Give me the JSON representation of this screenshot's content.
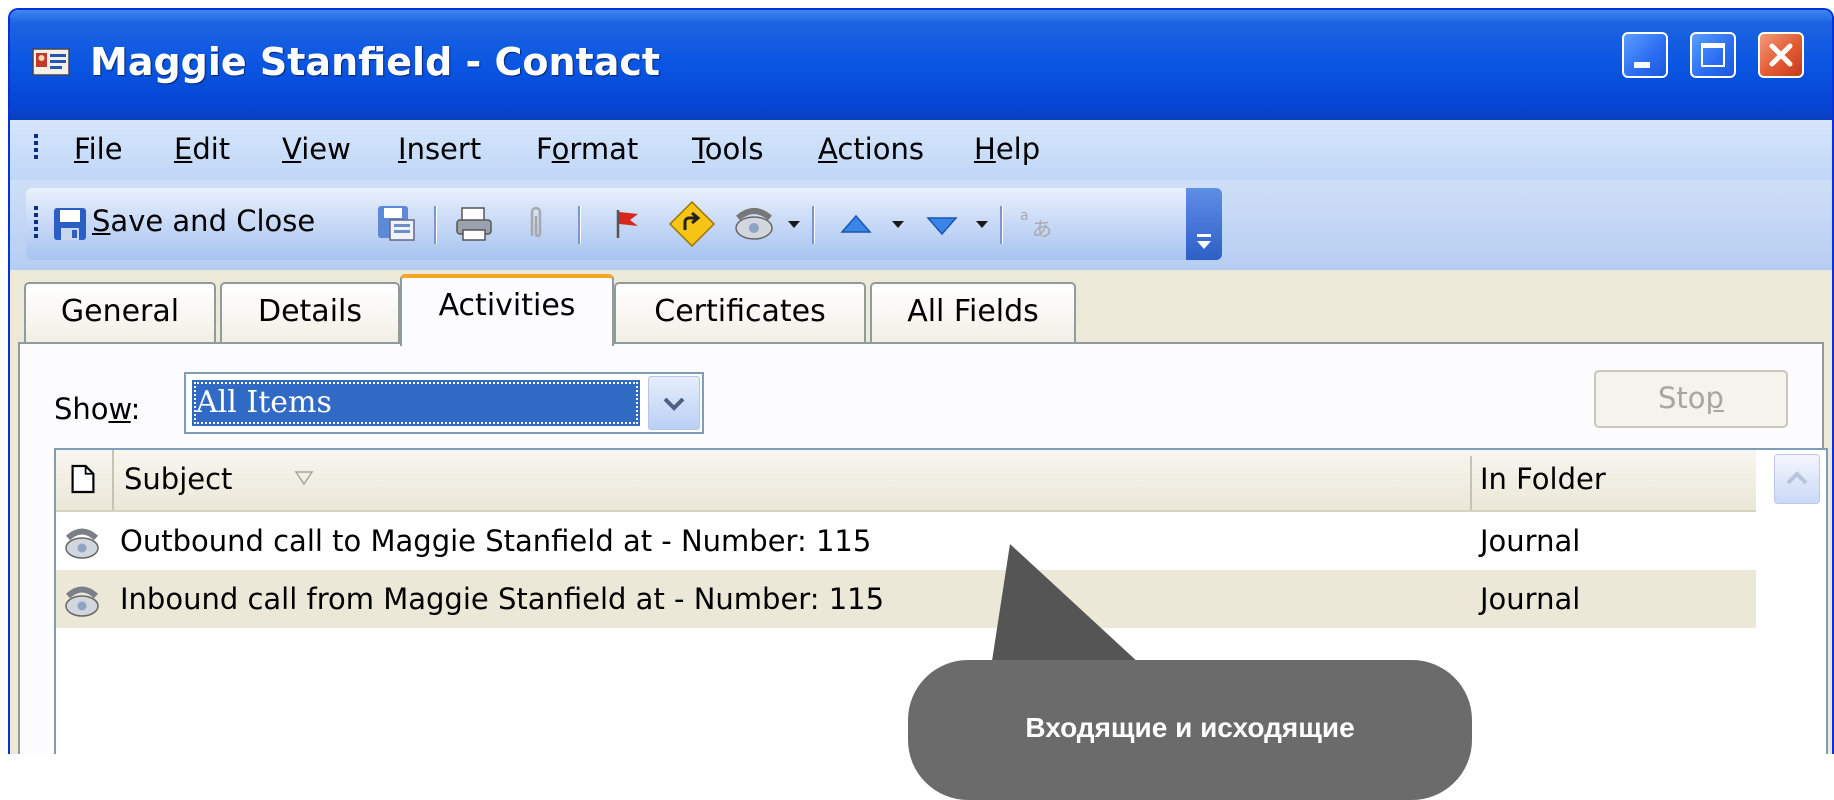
{
  "window": {
    "title": "Maggie Stanfield - Contact",
    "title_icon": "contact-card-icon",
    "controls": [
      "minimize-icon",
      "maximize-icon",
      "close-icon"
    ]
  },
  "menu": {
    "items": [
      {
        "label": "File",
        "accel": "F"
      },
      {
        "label": "Edit",
        "accel": "E"
      },
      {
        "label": "View",
        "accel": "V"
      },
      {
        "label": "Insert",
        "accel": "I"
      },
      {
        "label": "Format",
        "accel": "o"
      },
      {
        "label": "Tools",
        "accel": "T"
      },
      {
        "label": "Actions",
        "accel": "A"
      },
      {
        "label": "Help",
        "accel": "H"
      }
    ]
  },
  "toolbar": {
    "save_close_label": "Save and Close",
    "icons": [
      "save-disk-icon",
      "save-as-icon",
      "print-icon",
      "attach-paperclip-icon",
      "follow-up-flag-icon",
      "navigate-arrow-icon",
      "phone-dial-icon",
      "previous-item-icon",
      "next-item-icon",
      "translate-icon",
      "toolbar-options-icon"
    ]
  },
  "tabs": [
    {
      "label": "General",
      "active": false
    },
    {
      "label": "Details",
      "active": false
    },
    {
      "label": "Activities",
      "active": true
    },
    {
      "label": "Certificates",
      "active": false
    },
    {
      "label": "All Fields",
      "active": false
    }
  ],
  "activities": {
    "show_label": "Show:",
    "show_accel": "w",
    "show_value": "All Items",
    "stop_label": "Stop",
    "columns": {
      "subject": "Subject",
      "folder": "In Folder"
    },
    "rows": [
      {
        "subject": "Outbound call to Maggie Stanfield at  - Number: 115",
        "folder": "Journal",
        "icon": "phone-call-icon"
      },
      {
        "subject": "Inbound call from Maggie Stanfield at  - Number: 115",
        "folder": "Journal",
        "icon": "phone-call-icon"
      }
    ]
  },
  "callout": {
    "text": "Входящие и исходящие"
  },
  "colors": {
    "title_bar": "#0a56e2",
    "selection": "#316ac5",
    "active_tab_accent": "#f5a623",
    "callout": "#6b6b6b",
    "row_alt": "#ebe8d8"
  }
}
